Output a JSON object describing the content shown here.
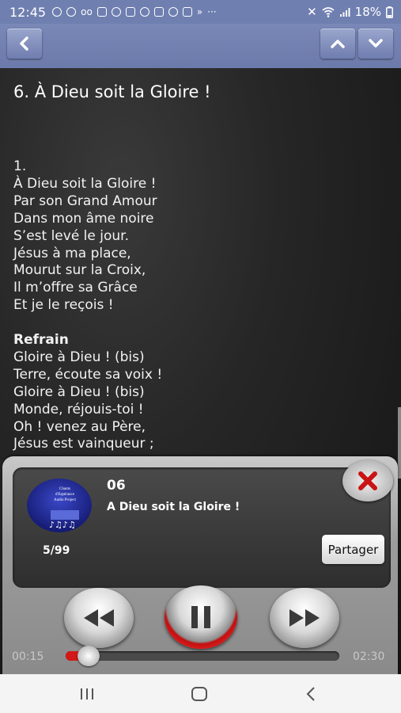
{
  "status_bar": {
    "time": "12:45",
    "battery": "18%"
  },
  "song": {
    "title": "6. À Dieu soit la Gloire !",
    "lyrics": [
      {
        "text": "1.",
        "bold": false
      },
      {
        "text": "À Dieu soit la Gloire !",
        "bold": false
      },
      {
        "text": "Par son Grand Amour",
        "bold": false
      },
      {
        "text": "Dans mon âme noire",
        "bold": false
      },
      {
        "text": "S’est levé le jour.",
        "bold": false
      },
      {
        "text": "Jésus à ma place,",
        "bold": false
      },
      {
        "text": "Mourut sur la Croix,",
        "bold": false
      },
      {
        "text": "Il m’offre sa Grâce",
        "bold": false
      },
      {
        "text": "Et je le reçois !",
        "bold": false
      },
      {
        "text": "",
        "bold": false
      },
      {
        "text": "Refrain",
        "bold": true
      },
      {
        "text": "Gloire à Dieu ! (bis)",
        "bold": false
      },
      {
        "text": "Terre, écoute sa voix !",
        "bold": false
      },
      {
        "text": "Gloire à Dieu ! (bis)",
        "bold": false
      },
      {
        "text": "Monde, réjouis-toi !",
        "bold": false
      },
      {
        "text": "Oh ! venez au Père,",
        "bold": false
      },
      {
        "text": "Jésus est vainqueur ;",
        "bold": false
      }
    ]
  },
  "player": {
    "track_number": "06",
    "track_title": "A Dieu soit la Gloire !",
    "track_counter": "5/99",
    "share_label": "Partager",
    "elapsed": "00:15",
    "total": "02:30",
    "progress": 0.1,
    "album_art_lines": [
      "Chants",
      "d'Espérance",
      "Audio Project"
    ]
  },
  "colors": {
    "app_bar": "#6f7db0",
    "accent_red": "#d21818"
  },
  "icons": {
    "back": "chevron-left-icon",
    "prev": "chevron-up-icon",
    "next": "chevron-down-icon",
    "close": "close-icon",
    "rewind": "rewind-icon",
    "pause": "pause-icon",
    "forward": "fast-forward-icon",
    "recent": "recent-apps-icon",
    "home": "home-icon",
    "sys_back": "back-icon"
  }
}
